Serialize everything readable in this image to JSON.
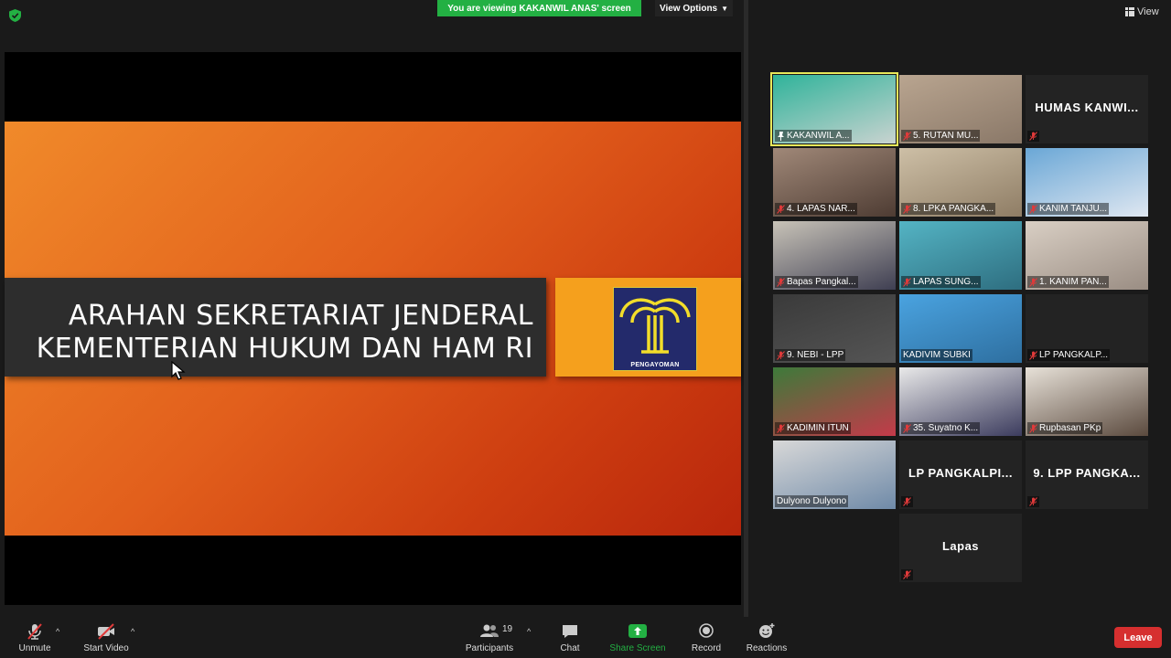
{
  "header": {
    "viewing_banner": "You are viewing KAKANWIL ANAS' screen",
    "view_options": "View Options",
    "view_button": "View"
  },
  "slide": {
    "title_line1": "ARAHAN SEKRETARIAT JENDERAL",
    "title_line2": "KEMENTERIAN HUKUM DAN HAM RI",
    "logo_text": "PENGAYOMAN"
  },
  "participants": [
    {
      "label": "KAKANWIL A...",
      "video": true,
      "active": true,
      "pinned": true
    },
    {
      "label": "5. RUTAN MU...",
      "video": true,
      "muted": true
    },
    {
      "label": "",
      "display_name": "HUMAS KANWI...",
      "video": false,
      "muted": true
    },
    {
      "label": "4. LAPAS NAR...",
      "video": true,
      "muted": true
    },
    {
      "label": "8. LPKA PANGKA...",
      "video": true,
      "muted": true
    },
    {
      "label": "KANIM TANJU...",
      "video": true,
      "muted": true
    },
    {
      "label": "Bapas Pangkal...",
      "video": true,
      "muted": true
    },
    {
      "label": "LAPAS SUNG...",
      "video": true,
      "muted": true
    },
    {
      "label": "1. KANIM PAN...",
      "video": true,
      "muted": true
    },
    {
      "label": "9. NEBI - LPP",
      "video": true,
      "muted": true
    },
    {
      "label": "KADIVIM SUBKI",
      "video": true,
      "muted": false
    },
    {
      "label": "LP PANGKALP...",
      "video": false,
      "muted": true
    },
    {
      "label": "KADIMIN ITUN",
      "video": true,
      "muted": true
    },
    {
      "label": "35. Suyatno K...",
      "video": true,
      "muted": true
    },
    {
      "label": "Rupbasan PKp",
      "video": true,
      "muted": true
    },
    {
      "label": "Dulyono Dulyono",
      "video": true,
      "muted": false
    },
    {
      "label": "",
      "display_name": "LP PANGKALPI...",
      "video": false,
      "muted": true
    },
    {
      "label": "",
      "display_name": "9. LPP PANGKA...",
      "video": false,
      "muted": true
    },
    {
      "label": "",
      "display_name": "Lapas",
      "video": false,
      "muted": true
    }
  ],
  "toolbar": {
    "unmute": "Unmute",
    "start_video": "Start Video",
    "participants": "Participants",
    "participant_count": "19",
    "chat": "Chat",
    "share_screen": "Share Screen",
    "record": "Record",
    "reactions": "Reactions",
    "leave": "Leave"
  },
  "colors": {
    "share_green": "#23b043",
    "leave_red": "#d62f2f",
    "active_speaker": "#e8e85a"
  }
}
